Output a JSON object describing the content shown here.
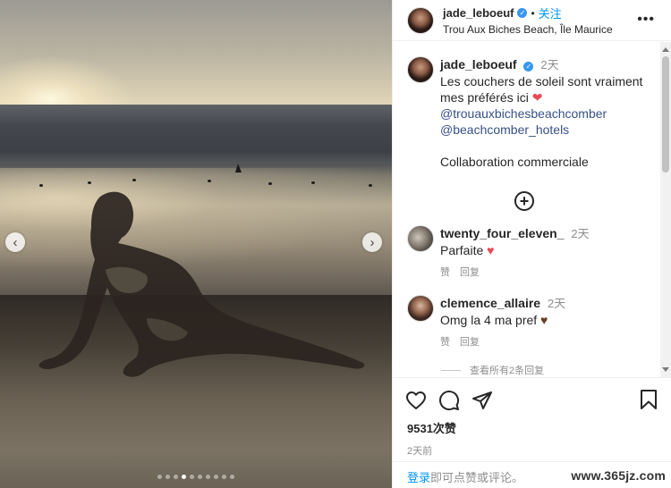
{
  "post": {
    "image_alt": "",
    "carousel": {
      "total_slides": 10,
      "active_index": 3
    }
  },
  "header": {
    "username": "jade_leboeuf",
    "separator": "•",
    "follow_label": "关注",
    "location": "Trou Aux Biches Beach, Île Maurice",
    "more_label": "•••"
  },
  "caption": {
    "username": "jade_leboeuf",
    "time": "2天",
    "text": "Les couchers de soleil sont vraiment mes préférés ici",
    "emoji": "❤",
    "mention1": "@trouauxbichesbeachcomber",
    "mention2": "@beachcomber_hotels",
    "collab": "Collaboration commerciale",
    "load_more": "+"
  },
  "comments": [
    {
      "username": "twenty_four_eleven_",
      "time": "2天",
      "text": "Parfaite",
      "emoji": "♥",
      "like_label": "赞",
      "reply_label": "回复"
    },
    {
      "username": "clemence_allaire",
      "time": "2天",
      "text": "Omg la 4 ma pref",
      "emoji": "♥",
      "like_label": "赞",
      "reply_label": "回复"
    }
  ],
  "view_replies_label": "查看所有2条回复",
  "stats": {
    "likes": "9531次赞",
    "posted_ago": "2天前"
  },
  "login_prompt": {
    "link": "登录",
    "text": "即可点赞或评论。"
  },
  "watermark": "www.365jz.com",
  "icons": {
    "like": "heart-outline-icon",
    "comment": "comment-bubble-icon",
    "share": "paper-plane-icon",
    "save": "bookmark-icon",
    "prev": "chevron-left-icon",
    "next": "chevron-right-icon"
  },
  "colors": {
    "link_blue": "#0095f6",
    "mention_blue": "#385185",
    "verified_blue": "#3897f0",
    "muted": "#8e8e8e"
  }
}
